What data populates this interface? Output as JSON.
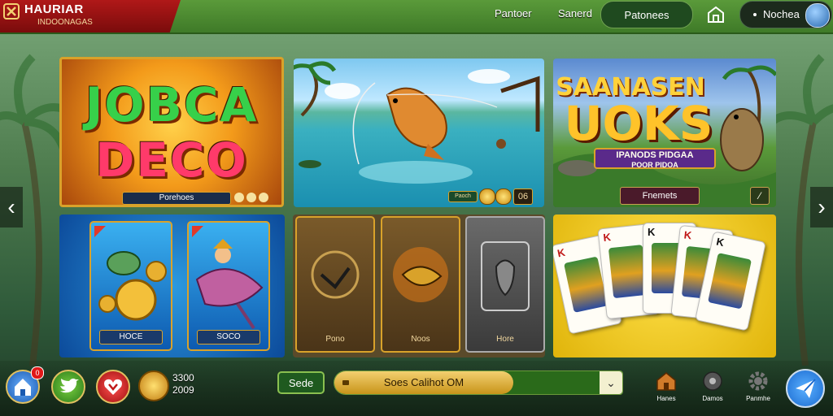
{
  "header": {
    "logo_title": "HAURIAR",
    "logo_subtitle": "INDOONAGAS",
    "links": [
      "Pantoer",
      "Sanerd"
    ],
    "active_pill": "Patonees",
    "user_label": "Nochea"
  },
  "tiles": {
    "featured": {
      "line1": "JOBCA",
      "line2": "DECO",
      "bar_label": "Porehoes"
    },
    "fishing": {
      "tag": "Paoch",
      "counter": "06"
    },
    "adventure": {
      "line1": "SAANASEN",
      "line2": "UOKS",
      "ribbon_line1": "IPANODS PIDGAA",
      "ribbon_line2": "POOR PIDOA",
      "button_label": "Fnemets"
    },
    "blue_cards": [
      "HOCE",
      "SOCO"
    ],
    "brown_cards": [
      "Pono",
      "Noos",
      "Hore"
    ]
  },
  "navigation": {
    "prev_arrow": "‹",
    "next_arrow": "›"
  },
  "bottom": {
    "notification_count": "0",
    "coins_line1": "3300",
    "coins_line2": "2009",
    "side_button": "Sede",
    "search_value": "Soes Calihot OM",
    "dropdown_glyph": "⌄",
    "nav_items": [
      "Hanes",
      "Damos",
      "Panmhe"
    ]
  },
  "colors": {
    "topbar": "#4a8a30",
    "logo_red": "#a01414",
    "gold": "#d9a22a",
    "send_blue": "#1a6ad0"
  }
}
